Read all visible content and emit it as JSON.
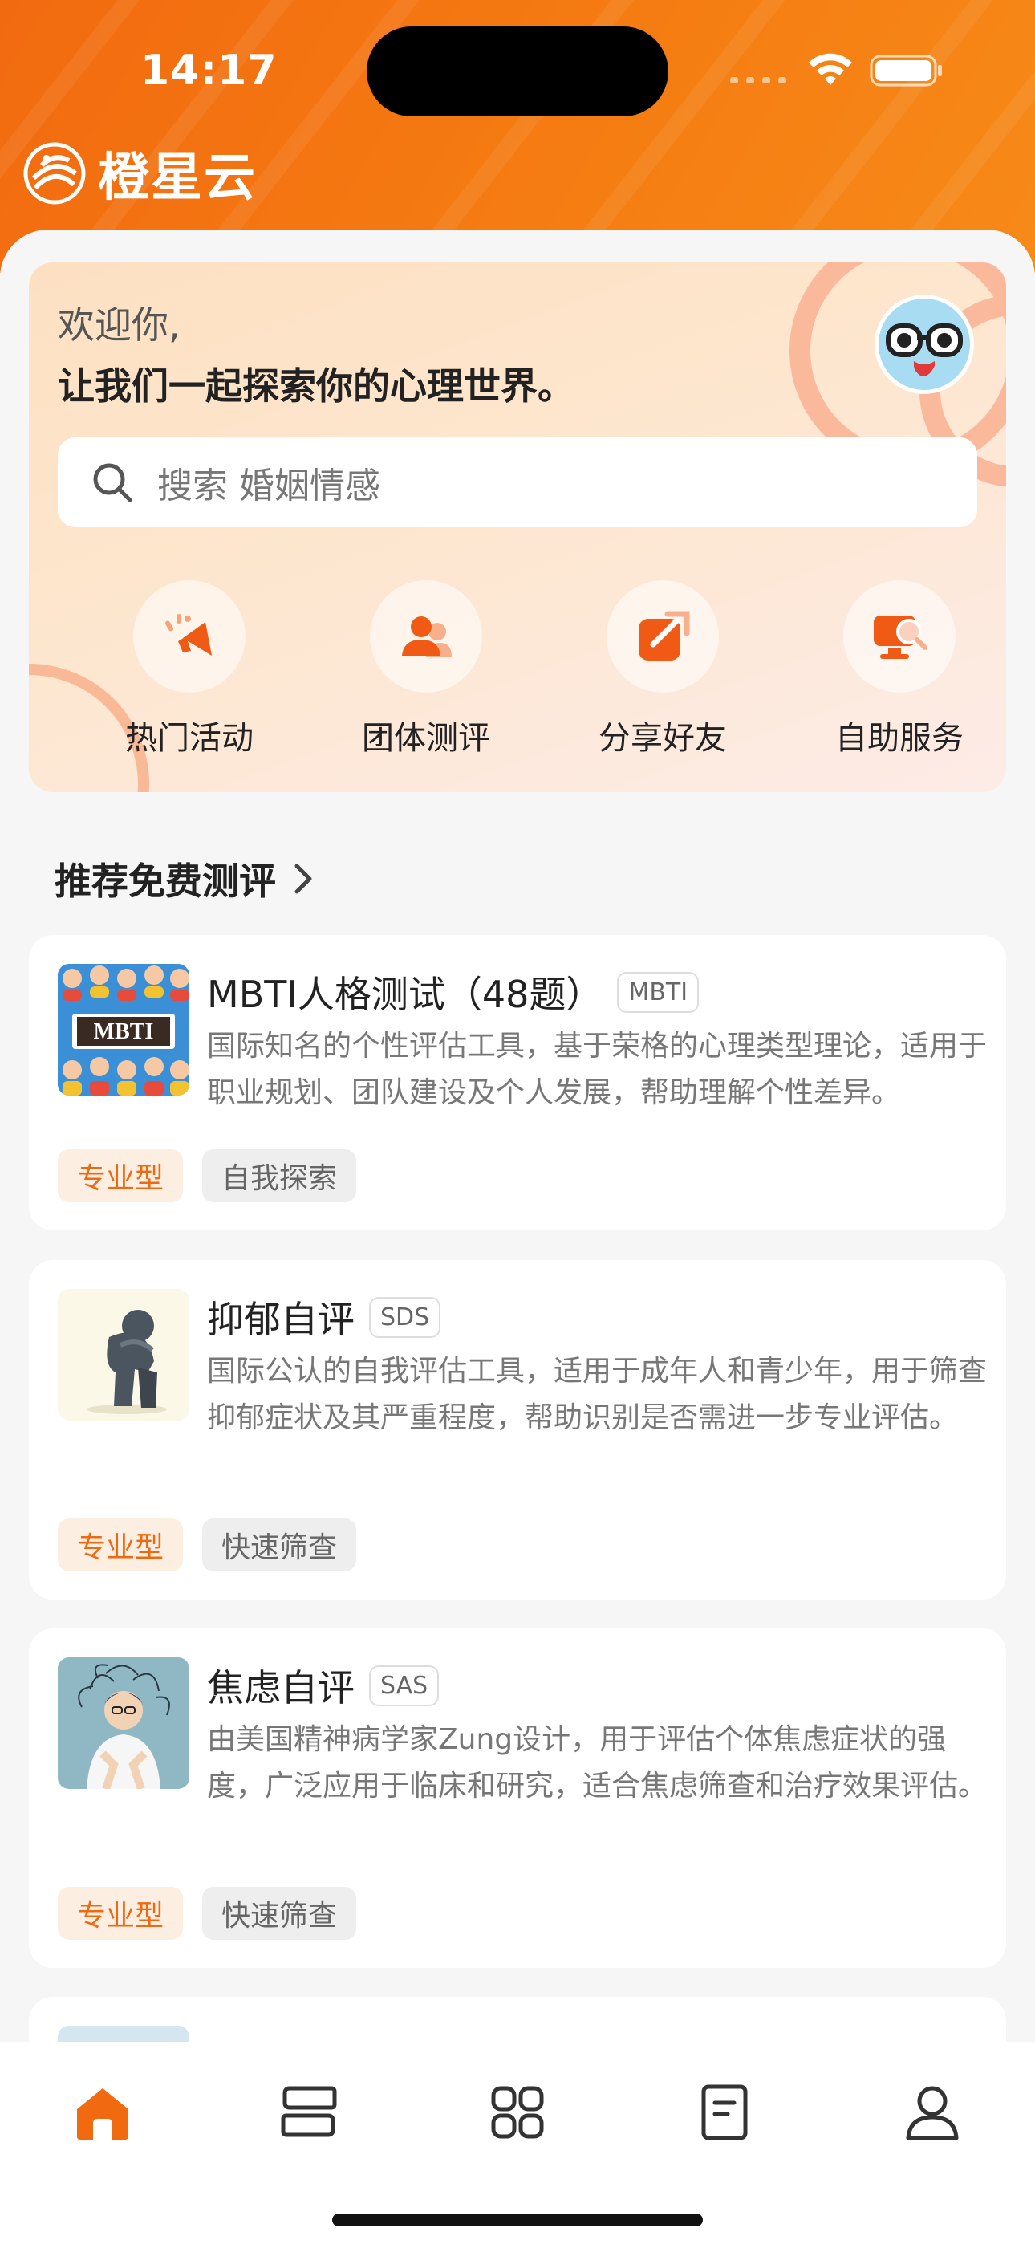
{
  "status_bar": {
    "time": "14:17"
  },
  "brand": {
    "name": "橙星云",
    "accent": "#f26a10"
  },
  "hero": {
    "greeting": "欢迎你,",
    "subtitle": "让我们一起探索你的心理世界。",
    "search_placeholder": "搜索 婚姻情感",
    "quick_actions": [
      {
        "label": "热门活动",
        "icon": "megaphone-icon"
      },
      {
        "label": "团体测评",
        "icon": "group-icon"
      },
      {
        "label": "分享好友",
        "icon": "share-icon"
      },
      {
        "label": "自助服务",
        "icon": "self-service-icon"
      }
    ]
  },
  "section": {
    "title": "推荐免费测评"
  },
  "cards": [
    {
      "title": "MBTI人格测试（48题）",
      "code": "MBTI",
      "thumb_text": "MBTI",
      "desc": "国际知名的个性评估工具，基于荣格的心理类型理论，适用于职业规划、团队建设及个人发展，帮助理解个性差异。",
      "tags": [
        "专业型",
        "自我探索"
      ]
    },
    {
      "title": "抑郁自评",
      "code": "SDS",
      "desc": "国际公认的自我评估工具，适用于成年人和青少年，用于筛查抑郁症状及其严重程度，帮助识别是否需进一步专业评估。",
      "tags": [
        "专业型",
        "快速筛查"
      ]
    },
    {
      "title": "焦虑自评",
      "code": "SAS",
      "desc": "由美国精神病学家Zung设计，用于评估个体焦虑症状的强度，广泛应用于临床和研究，适合焦虑筛查和治疗效果评估。",
      "tags": [
        "专业型",
        "快速筛查"
      ]
    }
  ],
  "tabbar": {
    "active_color": "#f26a10",
    "items": [
      {
        "icon": "home-icon",
        "active": true
      },
      {
        "icon": "list-icon",
        "active": false
      },
      {
        "icon": "grid-icon",
        "active": false
      },
      {
        "icon": "document-icon",
        "active": false
      },
      {
        "icon": "profile-icon",
        "active": false
      }
    ]
  }
}
